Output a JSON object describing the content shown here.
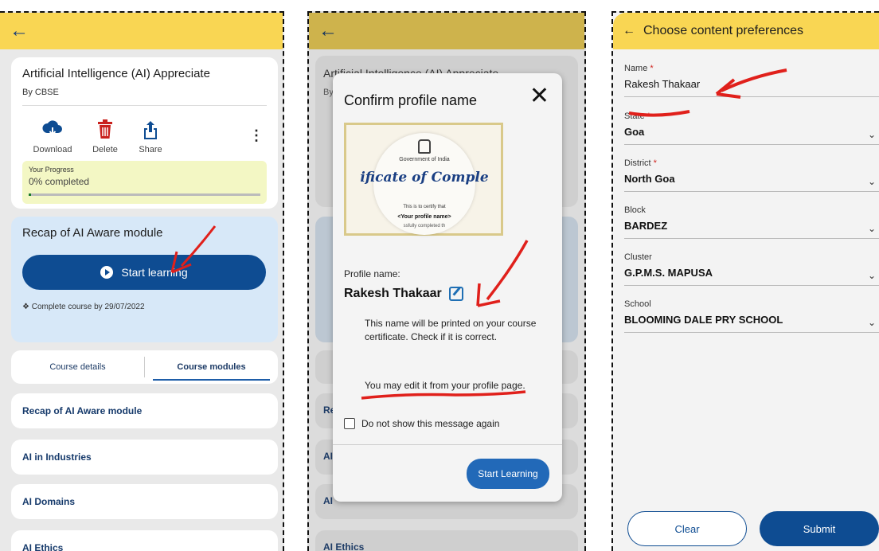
{
  "panel1": {
    "course": {
      "title": "Artificial Intelligence (AI) Appreciate",
      "by": "By CBSE",
      "actions": [
        "Download",
        "Delete",
        "Share"
      ],
      "progress_label": "Your Progress",
      "progress_value": "0% completed",
      "progress_fraction": 0.0
    },
    "recap": {
      "title": "Recap of AI Aware module",
      "button": "Start learning",
      "note": "Complete course by 29/07/2022"
    },
    "tabs": [
      "Course details",
      "Course modules"
    ],
    "modules": [
      "Recap of AI Aware module",
      "AI in Industries",
      "AI Domains",
      "AI Ethics"
    ]
  },
  "panel2": {
    "bg_title_fragment": "Artificial Intelligence (AI) Appreciate",
    "bg_by": "By",
    "bg_modules": [
      "Re",
      "AI",
      "AI",
      "AI Ethics"
    ],
    "modal": {
      "title": "Confirm profile name",
      "cert_gov": "Government of India",
      "cert_big": "ificate of Comple",
      "cert_small": "This is to certify that",
      "cert_name": "<Your profile name>",
      "cert_done": "ssfully completed th",
      "profile_label": "Profile name:",
      "profile_name": "Rakesh Thakaar",
      "body1": "This name will be printed on your course certificate. Check if it is correct.",
      "body2": "You may edit it from your profile page.",
      "checkbox": "Do not show this message again",
      "button": "Start Learning"
    }
  },
  "panel3": {
    "title": "Choose content preferences",
    "fields": [
      {
        "label": "Name",
        "required": "*",
        "value": "Rakesh Thakaar"
      },
      {
        "label": "State",
        "required": "*",
        "value": "Goa"
      },
      {
        "label": "District",
        "required": "*",
        "value": "North Goa"
      },
      {
        "label": "Block",
        "required": "",
        "value": "BARDEZ"
      },
      {
        "label": "Cluster",
        "required": "",
        "value": "G.P.M.S. MAPUSA"
      },
      {
        "label": "School",
        "required": "",
        "value": "BLOOMING DALE PRY SCHOOL"
      }
    ],
    "clear": "Clear",
    "submit": "Submit"
  },
  "colors": {
    "header": "#f9d653",
    "primary": "#0e4c92",
    "annotation": "#e0201b"
  }
}
